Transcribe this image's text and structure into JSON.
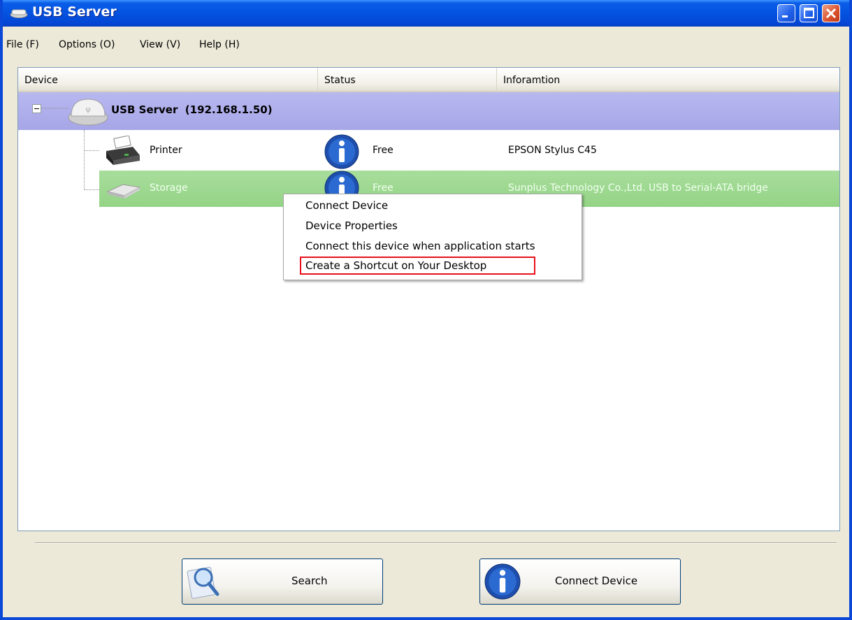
{
  "window": {
    "title": "USB Server",
    "controls": [
      "minimize",
      "maximize",
      "close"
    ]
  },
  "menubar": {
    "items": [
      "File (F)",
      "Options (O)",
      "View (V)",
      "Help (H)"
    ]
  },
  "listview": {
    "columns": [
      "Device",
      "Status",
      "Inforamtion"
    ],
    "server": {
      "label": "USB Server  (192.168.1.50)",
      "icon": "usb-server-icon"
    },
    "devices": [
      {
        "name": "Printer",
        "status": "Free",
        "info": "EPSON Stylus C45",
        "icon": "printer-icon"
      },
      {
        "name": "Storage",
        "status": "Free",
        "info": "Sunplus Technology Co.,Ltd. USB to Serial-ATA bridge",
        "icon": "storage-icon"
      }
    ]
  },
  "context_menu": {
    "items": [
      "Connect Device",
      "Device Properties",
      "Connect this device when application starts",
      "Create a Shortcut on Your Desktop"
    ],
    "highlighted_item": "Create a Shortcut on Your Desktop"
  },
  "buttons": {
    "search": "Search",
    "connect": "Connect Device"
  },
  "colors": {
    "title_bar": "#0453e0",
    "server_row": "#b0b0ec",
    "selected_row": "#9dd890",
    "highlight_box": "#e8101c",
    "info_icon": "#1e4fae"
  }
}
